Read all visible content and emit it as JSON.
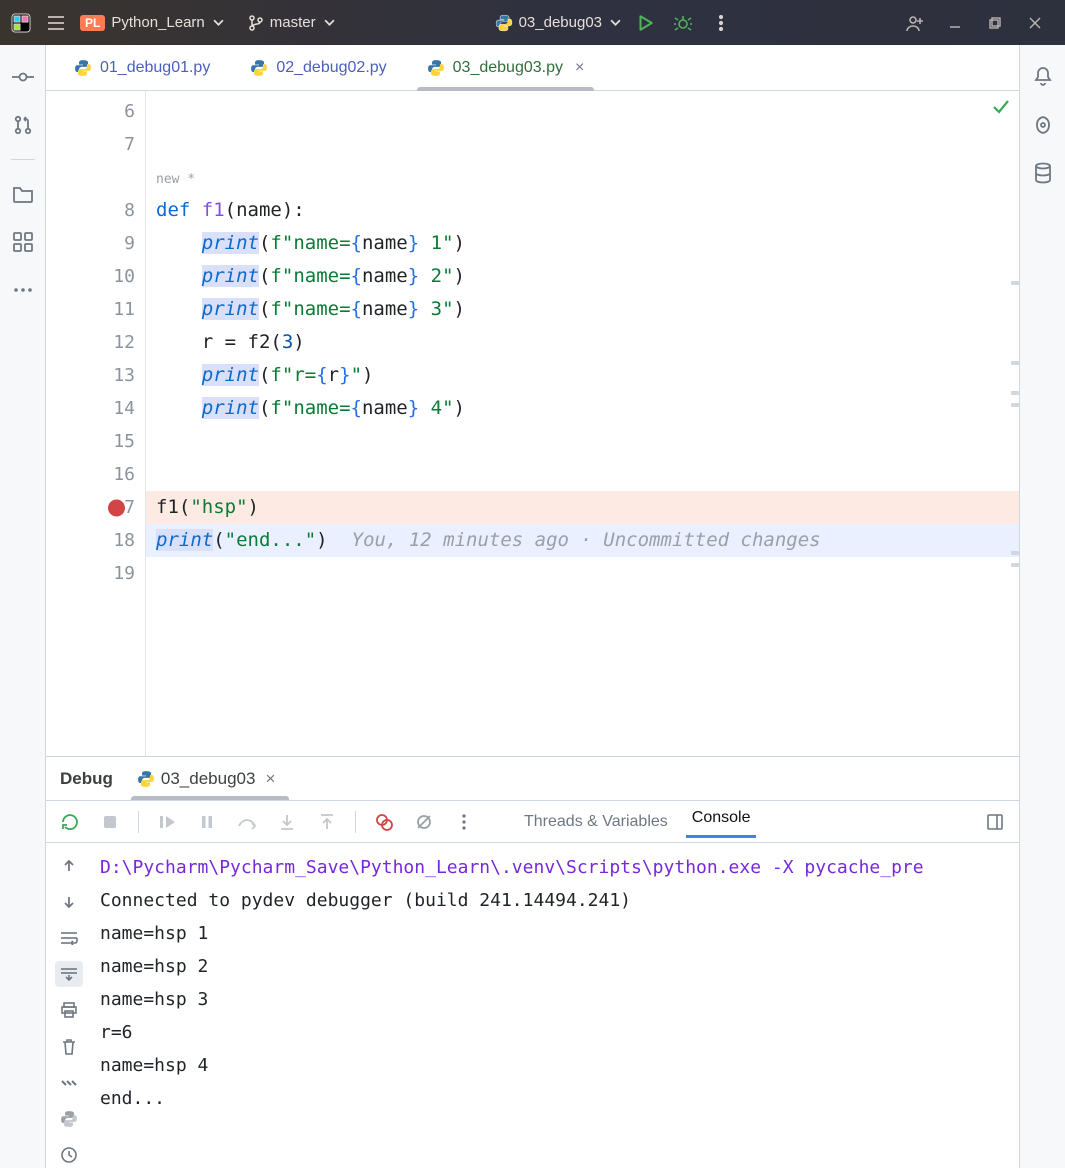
{
  "titlebar": {
    "project_badge": "PL",
    "project_name": "Python_Learn",
    "vcs_branch": "master",
    "run_config": "03_debug03"
  },
  "left_tools": [
    "commit",
    "pull-requests",
    "files",
    "structure",
    "more"
  ],
  "right_tools": [
    "notifications",
    "ai",
    "database"
  ],
  "editor_tabs": [
    {
      "label": "01_debug01.py",
      "active": false
    },
    {
      "label": "02_debug02.py",
      "active": false
    },
    {
      "label": "03_debug03.py",
      "active": true
    }
  ],
  "editor": {
    "inlay_hint": "new *",
    "breakpoint_line": 17,
    "cursor_line": 18,
    "inline_blame": "You, 12 minutes ago · Uncommitted changes",
    "lines": [
      {
        "n": 6,
        "tokens": []
      },
      {
        "n": 7,
        "tokens": []
      },
      {
        "n": 8,
        "tokens": [
          {
            "t": "def ",
            "c": "kw"
          },
          {
            "t": "f1",
            "c": "def"
          },
          {
            "t": "(name):"
          }
        ]
      },
      {
        "n": 9,
        "tokens": [
          {
            "t": "    "
          },
          {
            "t": "print",
            "c": "fn selbg"
          },
          {
            "t": "("
          },
          {
            "t": "f",
            "c": "str"
          },
          {
            "t": "\"name=",
            "c": "str"
          },
          {
            "t": "{",
            "c": "fbr"
          },
          {
            "t": "name"
          },
          {
            "t": "}",
            "c": "fbr"
          },
          {
            "t": " 1\"",
            "c": "str"
          },
          {
            "t": ")"
          }
        ]
      },
      {
        "n": 10,
        "tokens": [
          {
            "t": "    "
          },
          {
            "t": "print",
            "c": "fn selbg"
          },
          {
            "t": "("
          },
          {
            "t": "f",
            "c": "str"
          },
          {
            "t": "\"name=",
            "c": "str"
          },
          {
            "t": "{",
            "c": "fbr"
          },
          {
            "t": "name"
          },
          {
            "t": "}",
            "c": "fbr"
          },
          {
            "t": " 2\"",
            "c": "str"
          },
          {
            "t": ")"
          }
        ]
      },
      {
        "n": 11,
        "tokens": [
          {
            "t": "    "
          },
          {
            "t": "print",
            "c": "fn selbg"
          },
          {
            "t": "("
          },
          {
            "t": "f",
            "c": "str"
          },
          {
            "t": "\"name=",
            "c": "str"
          },
          {
            "t": "{",
            "c": "fbr"
          },
          {
            "t": "name"
          },
          {
            "t": "}",
            "c": "fbr"
          },
          {
            "t": " 3\"",
            "c": "str"
          },
          {
            "t": ")"
          }
        ]
      },
      {
        "n": 12,
        "tokens": [
          {
            "t": "    r = f2("
          },
          {
            "t": "3",
            "c": "num"
          },
          {
            "t": ")"
          }
        ]
      },
      {
        "n": 13,
        "tokens": [
          {
            "t": "    "
          },
          {
            "t": "print",
            "c": "fn selbg"
          },
          {
            "t": "("
          },
          {
            "t": "f",
            "c": "str"
          },
          {
            "t": "\"r=",
            "c": "str"
          },
          {
            "t": "{",
            "c": "fbr"
          },
          {
            "t": "r"
          },
          {
            "t": "}",
            "c": "fbr"
          },
          {
            "t": "\"",
            "c": "str"
          },
          {
            "t": ")"
          }
        ]
      },
      {
        "n": 14,
        "tokens": [
          {
            "t": "    "
          },
          {
            "t": "print",
            "c": "fn selbg"
          },
          {
            "t": "("
          },
          {
            "t": "f",
            "c": "str"
          },
          {
            "t": "\"name=",
            "c": "str"
          },
          {
            "t": "{",
            "c": "fbr"
          },
          {
            "t": "name"
          },
          {
            "t": "}",
            "c": "fbr"
          },
          {
            "t": " 4\"",
            "c": "str"
          },
          {
            "t": ")"
          }
        ]
      },
      {
        "n": 15,
        "tokens": []
      },
      {
        "n": 16,
        "tokens": []
      },
      {
        "n": 17,
        "tokens": [
          {
            "t": "f1("
          },
          {
            "t": "\"hsp\"",
            "c": "str"
          },
          {
            "t": ")"
          }
        ]
      },
      {
        "n": 18,
        "tokens": [
          {
            "t": "print",
            "c": "fn selbg"
          },
          {
            "t": "("
          },
          {
            "t": "\"end...\"",
            "c": "str"
          },
          {
            "t": ")"
          }
        ]
      },
      {
        "n": 19,
        "tokens": []
      }
    ]
  },
  "debug": {
    "tab_label": "Debug",
    "session": "03_debug03",
    "view_tabs": {
      "vars": "Threads & Variables",
      "console": "Console"
    },
    "active_view": "console",
    "console_gutter": [
      "up",
      "down",
      "soft-wrap",
      "scroll-end",
      "print",
      "trash",
      "more",
      "python",
      "history"
    ],
    "console_lines": [
      {
        "cmd": true,
        "text": "D:\\Pycharm\\Pycharm_Save\\Python_Learn\\.venv\\Scripts\\python.exe -X pycache_pre"
      },
      {
        "text": "Connected to pydev debugger (build 241.14494.241)"
      },
      {
        "text": "name=hsp 1"
      },
      {
        "text": "name=hsp 2"
      },
      {
        "text": "name=hsp 3"
      },
      {
        "text": "r=6"
      },
      {
        "text": "name=hsp 4"
      },
      {
        "text": "end..."
      }
    ]
  }
}
